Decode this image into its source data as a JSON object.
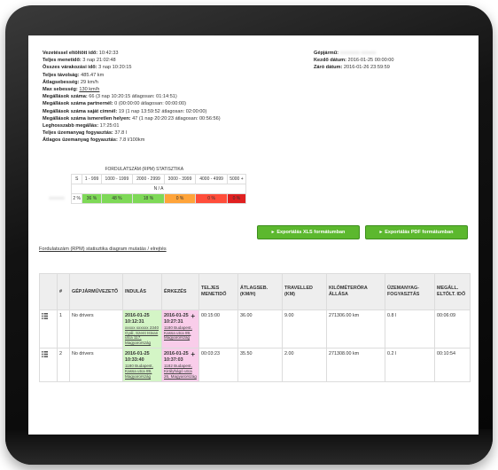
{
  "colors": {
    "ok": "#5cb82e",
    "green_start": "#d4f5c6",
    "pink_end": "#f9cdea"
  },
  "summary": [
    {
      "label": "Vezetéssel eltöltött idő:",
      "value": "10:42:33"
    },
    {
      "label": "Teljes menetidő:",
      "value": "3 nap 21:02:48"
    },
    {
      "label": "Összes várakozási idő:",
      "value": "3 nap 10:20:15"
    },
    {
      "label": "Teljes távolság:",
      "value": "485.47 km"
    },
    {
      "label": "Átlagsebesség:",
      "value": "29 km/h"
    },
    {
      "label": "Max sebesség:",
      "value": "130 km/h",
      "underline": true
    },
    {
      "label": "Megállások száma:",
      "value": "66 (3 nap 10:20:15 átlagosan: 01:14:51)"
    },
    {
      "label": "Megállások száma partnernél:",
      "value": "0 (00:00:00 átlagosan: 00:00:00)"
    },
    {
      "label": "Megállások száma saját címnél:",
      "value": "19 (1 nap 13:59:52 átlagosan: 02:00:00)"
    },
    {
      "label": "Megállások száma ismeretlen helyen:",
      "value": "47 (1 nap 20:20:23 átlagosan: 00:56:56)"
    },
    {
      "label": "Leghosszabb megállás:",
      "value": "17:25:01"
    },
    {
      "label": "Teljes üzemanyag fogyasztás:",
      "value": "37.8 l"
    },
    {
      "label": "Átlagos üzemanyag fogyasztás:",
      "value": "7.8 l/100km"
    }
  ],
  "right_info": [
    {
      "label": "Gépjármű:",
      "value": "xxxxxxxx xxxxxx"
    },
    {
      "label": "Kezdő dátum:",
      "value": "2016-01-25 00:00:00"
    },
    {
      "label": "Záró dátum:",
      "value": "2016-01-26 23:59:59"
    }
  ],
  "rpm": {
    "title": "FORDULATSZÁM (RPM) STATISZTIKA",
    "headers": [
      "S",
      "1 - 999",
      "1000 - 1999",
      "2000 - 2999",
      "3000 - 3999",
      "4000 - 4999",
      "5000 +"
    ],
    "na": "N / A",
    "row_label": "xxxxxxx",
    "row_values": [
      "2 %",
      "36 %",
      "48 %",
      "18 %",
      "0 %",
      "0 %",
      "0 %"
    ],
    "row_colors": [
      "#ffffff",
      "#7ed957",
      "#7ed957",
      "#7ed957",
      "#ffa43a",
      "#ff4d3a",
      "#e02020"
    ]
  },
  "buttons": {
    "xls": "Exportálás XLS formátumban",
    "pdf": "Exportálás PDF formátumban"
  },
  "rpm_link": "Fordulatszám (RPM) statisztika diagram mutatás / elrejtés",
  "columns": [
    "",
    "#",
    "GÉPJÁRMŰVEZETŐ",
    "INDULÁS",
    "ÉRKEZÉS",
    "TELJES MENETIDŐ",
    "ÁTLAGSEB. (KM/H)",
    "TRAVELLED (KM)",
    "KILÓMÉTERÓRA ÁLLÁSA",
    "ÜZEMANYAG-FOGYASZTÁS",
    "MEGÁLL. ELTÖLT. IDŐ"
  ],
  "rows": [
    {
      "num": "1",
      "driver": "No drivers",
      "start_time": "2016-01-25 10:12:31",
      "start_addr": "xxxxx xxxxxx 2340 Gyál, Szent Istvan utca 117, Magyarország",
      "end_time": "2016-01-25 10:27:31",
      "end_addr": "1180 Budapest, Kassa utca 89, Magyarország",
      "total": "00:15:00",
      "avg": "36.00",
      "km": "9.00",
      "odo": "271306.00 km",
      "fuel": "0.8 l",
      "stop": "00:06:09"
    },
    {
      "num": "2",
      "driver": "No drivers",
      "start_time": "2016-01-25 10:33:40",
      "start_addr": "1180 Budapest, Kassa utca 89, Magyarország",
      "end_time": "2016-01-25 10:37:03",
      "end_addr": "1182 Budapest, Királyhágó utca 26, Magyarország",
      "total": "00:03:23",
      "avg": "35.50",
      "km": "2.00",
      "odo": "271308.00 km",
      "fuel": "0.2 l",
      "stop": "00:10:54"
    }
  ]
}
